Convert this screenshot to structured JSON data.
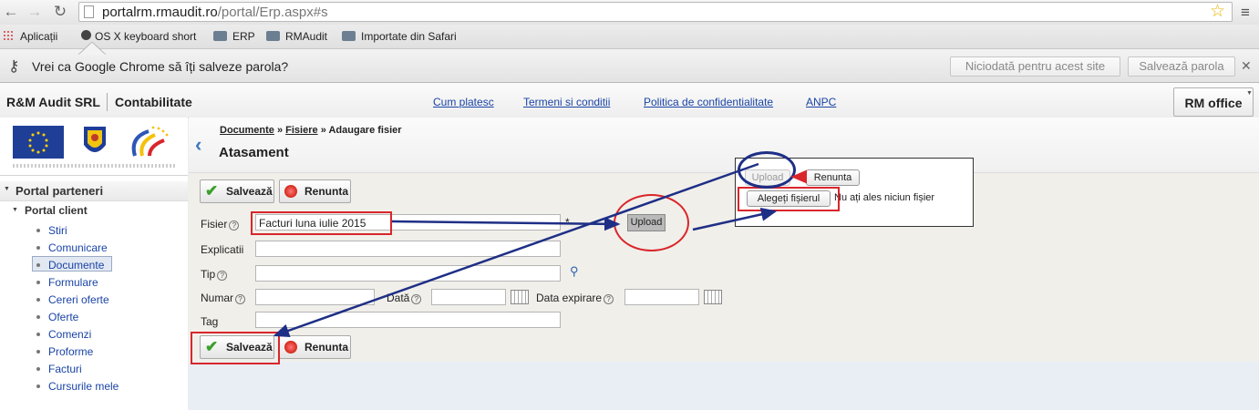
{
  "browser": {
    "url_host": "portalrm.rmaudit.ro",
    "url_path": "/portal/Erp.aspx#s",
    "bookmarks": [
      "Aplicații",
      "OS X keyboard short",
      "ERP",
      "RMAudit",
      "Importate din Safari"
    ],
    "password_prompt": "Vrei ca Google Chrome să îți salveze parola?",
    "never_button": "Niciodată pentru acest site",
    "save_button": "Salvează parola"
  },
  "header": {
    "company": "R&M Audit SRL",
    "module": "Contabilitate",
    "links": [
      "Cum platesc",
      "Termeni si conditii",
      "Politica de confidentialitate",
      "ANPC"
    ],
    "app_button": "RM office"
  },
  "sidebar": {
    "section": "Portal parteneri",
    "subsection": "Portal client",
    "items": [
      "Stiri",
      "Comunicare",
      "Documente",
      "Formulare",
      "Cereri oferte",
      "Oferte",
      "Comenzi",
      "Proforme",
      "Facturi",
      "Cursurile mele"
    ],
    "selected": "Documente"
  },
  "breadcrumb": {
    "items": [
      "Documente",
      "Fisiere",
      "Adaugare fisier"
    ],
    "separator": "»"
  },
  "page_title": "Atasament",
  "form": {
    "save": "Salvează",
    "cancel": "Renunta",
    "fisier_label": "Fisier",
    "fisier_value": "Facturi luna iulie 2015",
    "required_mark": "*",
    "upload": "Upload",
    "explicatii_label": "Explicatii",
    "tip_label": "Tip",
    "numar_label": "Numar",
    "data_label": "Dată",
    "data_expirare_label": "Data expirare",
    "tag_label": "Tag"
  },
  "popup": {
    "upload": "Upload",
    "cancel": "Renunta",
    "choose_file": "Alegeți fișierul",
    "no_file": "Nu ați ales niciun fișier"
  },
  "colors": {
    "link": "#1a44a6",
    "annotation_red": "#d9262b",
    "annotation_blue": "#1e2f86"
  }
}
